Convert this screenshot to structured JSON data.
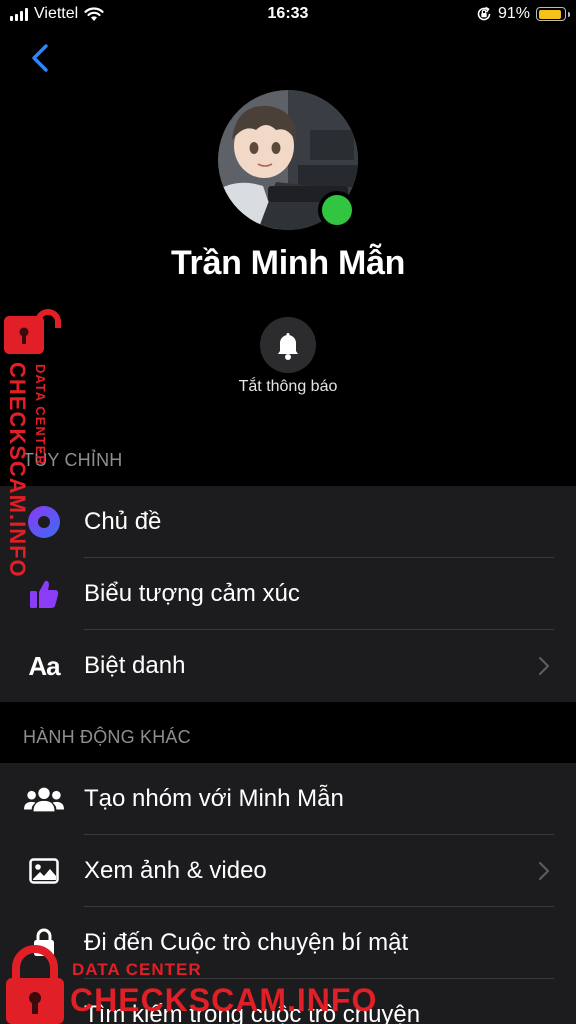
{
  "status_bar": {
    "carrier": "Viettel",
    "time": "16:33",
    "battery_percent": "91%",
    "battery_level": 0.91
  },
  "profile": {
    "name": "Trần Minh Mẫn",
    "online": true,
    "mute_label": "Tắt thông báo"
  },
  "customize": {
    "header": "TÙY CHỈNH",
    "items": [
      {
        "label": "Chủ đề",
        "icon": "theme-icon"
      },
      {
        "label": "Biểu tượng cảm xúc",
        "icon": "thumbs-up-icon"
      },
      {
        "label": "Biệt danh",
        "icon": "nickname-icon",
        "icon_text": "Aa"
      }
    ]
  },
  "more_actions": {
    "header": "HÀNH ĐỘNG KHÁC",
    "items": [
      {
        "label": "Tạo nhóm với Minh Mẫn",
        "icon": "people-icon"
      },
      {
        "label": "Xem ảnh & video",
        "icon": "photo-icon"
      },
      {
        "label": "Đi đến Cuộc trò chuyện bí mật",
        "icon": "lock-icon"
      },
      {
        "label": "Tìm kiếm trong cuộc trò chuyện",
        "icon": "search-icon"
      }
    ]
  },
  "watermark": {
    "line1": "DATA CENTER",
    "line2": "CHECKSCAM.INFO"
  },
  "colors": {
    "accent_blue": "#2d88ff",
    "online_green": "#31c540",
    "row_background": "#1c1c1e",
    "watermark_red": "#e01f26"
  }
}
